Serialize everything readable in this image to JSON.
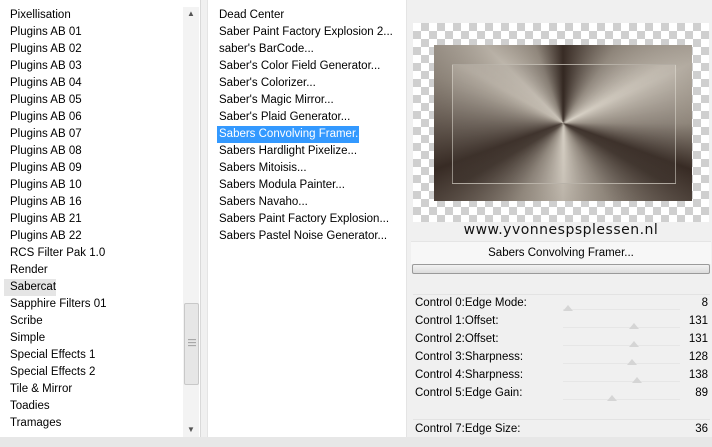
{
  "categories": {
    "items": [
      "Pixellisation",
      "Plugins AB 01",
      "Plugins AB 02",
      "Plugins AB 03",
      "Plugins AB 04",
      "Plugins AB 05",
      "Plugins AB 06",
      "Plugins AB 07",
      "Plugins AB 08",
      "Plugins AB 09",
      "Plugins AB 10",
      "Plugins AB 16",
      "Plugins AB 21",
      "Plugins AB 22",
      "RCS Filter Pak 1.0",
      "Render",
      "Sabercat",
      "Sapphire Filters 01",
      "Scribe",
      "Simple",
      "Special Effects 1",
      "Special Effects 2",
      "Tile & Mirror",
      "Toadies",
      "Tramages"
    ],
    "selected": "Sabercat"
  },
  "filters": {
    "items": [
      "Dead Center",
      "Saber Paint Factory Explosion 2...",
      "saber's BarCode...",
      "Saber's Color Field Generator...",
      "Saber's Colorizer...",
      "Saber's Magic Mirror...",
      "Saber's Plaid Generator...",
      "Sabers Convolving Framer...",
      "Sabers Hardlight Pixelize...",
      "Sabers Mitoisis...",
      "Sabers Modula Painter...",
      "Sabers Navaho...",
      "Sabers Paint Factory Explosion...",
      "Sabers Pastel Noise Generator..."
    ],
    "selected": "Sabers Convolving Framer..."
  },
  "preview": {
    "watermark": "www.yvonnespsplessen.nl"
  },
  "filter_name": "Sabers Convolving Framer...",
  "controls": [
    {
      "label": "Control 0:Edge Mode:",
      "value": "8"
    },
    {
      "label": "Control 1:Offset:",
      "value": "131"
    },
    {
      "label": "Control 2:Offset:",
      "value": "131"
    },
    {
      "label": "Control 3:Sharpness:",
      "value": "128"
    },
    {
      "label": "Control 4:Sharpness:",
      "value": "138"
    },
    {
      "label": "Control 5:Edge Gain:",
      "value": "89"
    },
    {
      "label": "Control 7:Edge Size:",
      "value": "36"
    }
  ],
  "colors": {
    "selection": "#3399ff",
    "frame_dark": "#3b2e27",
    "frame_light": "#d9d2c6"
  },
  "icons": {
    "scroll_up": "triangle-up",
    "scroll_down": "triangle-down"
  }
}
